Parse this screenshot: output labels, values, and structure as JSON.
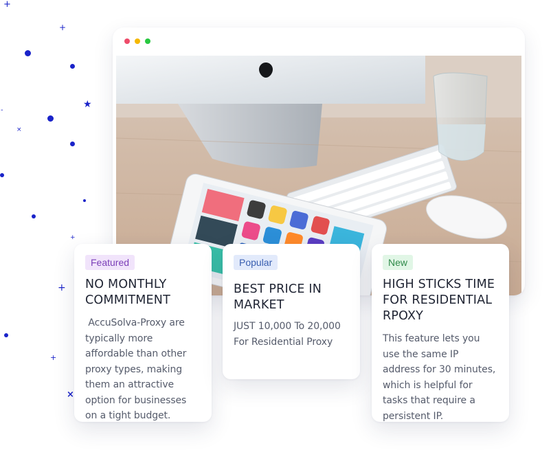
{
  "decorations": {
    "plus": "+",
    "cross": "×",
    "star": "★",
    "minus": "-",
    "color": "#1a23c9"
  },
  "browser": {
    "traffic_lights": [
      "#ee4b6a",
      "#f5b800",
      "#28c840"
    ],
    "image_alt": "Desk with iMac, keyboard, tablet, mouse and glass"
  },
  "cards": [
    {
      "badge": "Featured",
      "badge_bg": "#f1e4fb",
      "badge_color": "#7b3fb8",
      "title": "NO MONTHLY COMMITMENT",
      "text": " AccuSolva-Proxy are typically more affordable than other proxy types, making them an attractive option for businesses on a tight budget."
    },
    {
      "badge": "Popular",
      "badge_bg": "#e2eafb",
      "badge_color": "#3a5fb0",
      "title": "BEST PRICE IN MARKET",
      "text": "JUST 10,000 To 20,000 For Residential Proxy"
    },
    {
      "badge": "New",
      "badge_bg": "#e1f6e6",
      "badge_color": "#2f8a4a",
      "title": "HIGH STICKS TIME FOR RESIDENTIAL RPOXY",
      "text": "This feature lets you use the same IP address for 30 minutes, which is helpful for tasks that require a persistent IP."
    }
  ]
}
